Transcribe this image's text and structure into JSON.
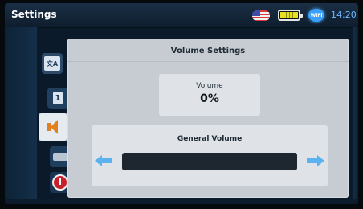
{
  "status_bar": {
    "title": "Settings",
    "wifi_label": "WiFi",
    "time": "14:20",
    "battery_level": 1.0
  },
  "sidebar": {
    "items": [
      {
        "name": "language",
        "icon": "language-icon",
        "glyph": "文A"
      },
      {
        "name": "display",
        "icon": "display-number-icon",
        "glyph": "1"
      },
      {
        "name": "volume",
        "icon": "speaker-icon",
        "selected": true
      },
      {
        "name": "storage",
        "icon": "storage-icon"
      },
      {
        "name": "power",
        "icon": "power-icon"
      }
    ]
  },
  "main": {
    "title": "Volume Settings",
    "readout_label": "Volume",
    "readout_value": "0%",
    "slider_title": "General Volume",
    "slider_level": 0.0
  },
  "colors": {
    "accent": "#4ea8e6",
    "selected_tab_icon": "#e08020",
    "clock": "#6fb8ff"
  }
}
